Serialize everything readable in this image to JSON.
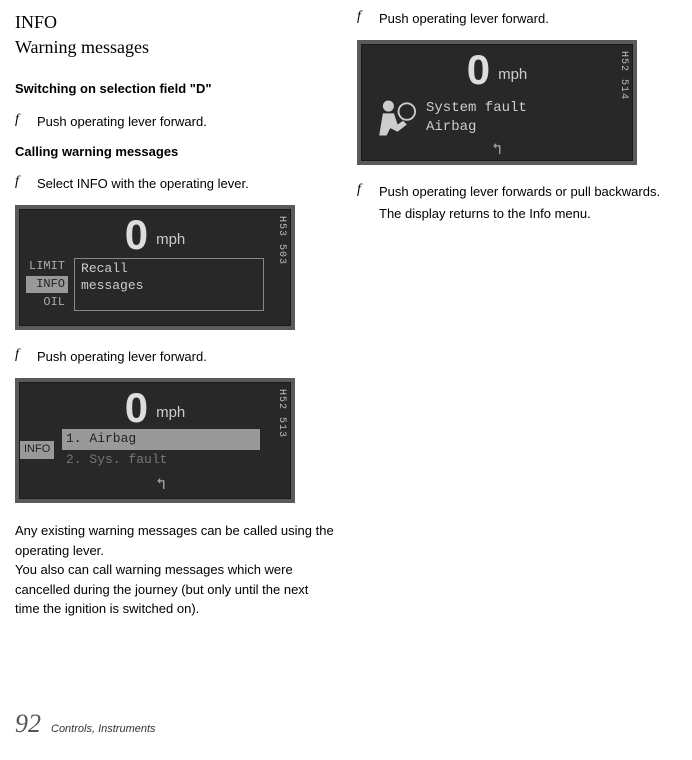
{
  "header": {
    "title": "INFO",
    "subtitle": "Warning messages"
  },
  "left": {
    "sub1": "Switching on selection field \"D\"",
    "step1": "Push operating lever forward.",
    "sub2": "Calling warning messages",
    "step2": "Select INFO with the operating lever.",
    "display1": {
      "tag": "H53 503",
      "speed": "0",
      "unit": "mph",
      "menu": {
        "item1": "LIMIT",
        "item2": "INFO",
        "item3": "OIL"
      },
      "box": {
        "line1": "Recall",
        "line2": "messages"
      }
    },
    "step3": "Push operating lever forward.",
    "display2": {
      "tag": "H52 513",
      "speed": "0",
      "unit": "mph",
      "label": "INFO",
      "item1": "1. Airbag",
      "item2": "2. Sys. fault",
      "back": "↰"
    },
    "body": "Any existing warning messages can be called using the operating lever.\nYou also can call warning messages which were cancelled during the journey (but only until the next time the ignition is switched on)."
  },
  "right": {
    "step1": "Push operating lever forward.",
    "display1": {
      "tag": "H52 514",
      "speed": "0",
      "unit": "mph",
      "line1": "System fault",
      "line2": "Airbag",
      "back": "↰"
    },
    "step2": "Push operating lever forwards or pull backwards.",
    "step2sub": "The display returns to the Info menu."
  },
  "footer": {
    "pagenum": "92",
    "text": "Controls, Instruments"
  }
}
